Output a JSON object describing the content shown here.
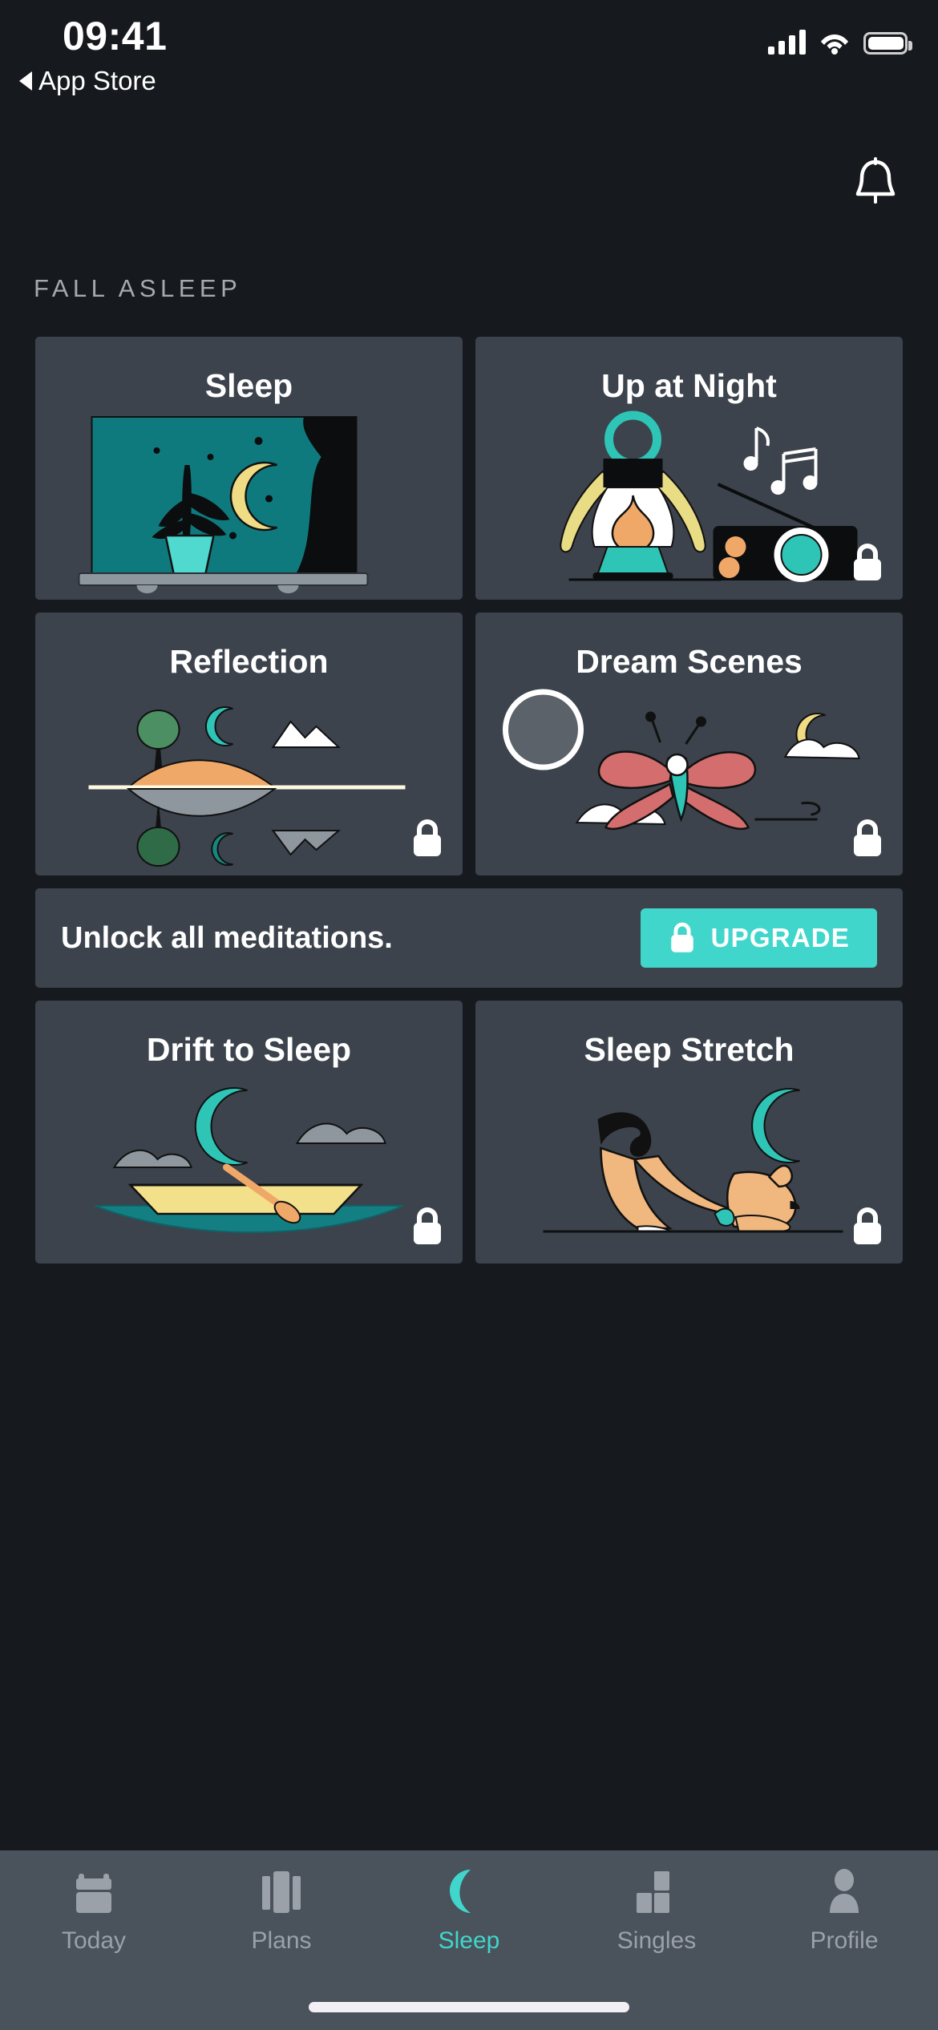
{
  "status_bar": {
    "time": "09:41",
    "back_label": "App Store",
    "back_icon": "triangle-left-icon",
    "signal_icon": "cellular-signal-icon",
    "wifi_icon": "wifi-icon",
    "battery_icon": "battery-full-icon"
  },
  "header": {
    "notifications_icon": "bell-icon"
  },
  "section": {
    "title": "FALL ASLEEP"
  },
  "cards": [
    {
      "title": "Sleep",
      "locked": false,
      "art": "night-window-plant-moon"
    },
    {
      "title": "Up at Night",
      "locked": true,
      "art": "lantern-radio-music-notes"
    },
    {
      "title": "Reflection",
      "locked": true,
      "art": "lake-hill-tree-moon-reflection"
    },
    {
      "title": "Dream Scenes",
      "locked": true,
      "art": "butterfly-moon-clouds"
    },
    {
      "title": "Drift to Sleep",
      "locked": true,
      "art": "rowboat-crescent-moon-clouds"
    },
    {
      "title": "Sleep Stretch",
      "locked": true,
      "art": "stretching-dog-crescent-moon"
    }
  ],
  "banner": {
    "text": "Unlock all meditations.",
    "button_label": "UPGRADE",
    "button_icon": "lock-icon",
    "accent_color": "#41D6CB"
  },
  "tabbar": {
    "items": [
      {
        "label": "Today",
        "icon": "calendar-icon",
        "active": false
      },
      {
        "label": "Plans",
        "icon": "cards-icon",
        "active": false
      },
      {
        "label": "Sleep",
        "icon": "moon-icon",
        "active": true
      },
      {
        "label": "Singles",
        "icon": "blocks-icon",
        "active": false
      },
      {
        "label": "Profile",
        "icon": "person-icon",
        "active": false
      }
    ],
    "active_color": "#41D6CB",
    "inactive_color": "#9AA1A8",
    "background": "#4A525B"
  },
  "colors": {
    "page_background": "#16191D",
    "card_background": "#3C434C",
    "accent_teal": "#41D6CB",
    "section_title": "#A7A9AC"
  }
}
